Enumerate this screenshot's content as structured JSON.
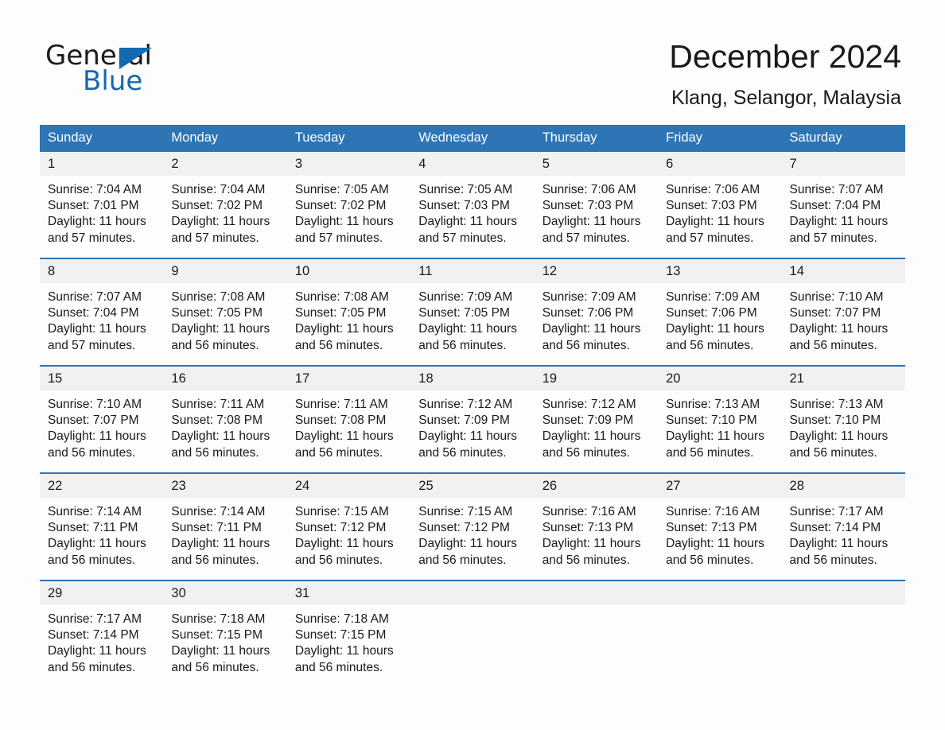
{
  "brand": {
    "name_part1": "General",
    "name_part2": "Blue",
    "triangle_icon": "triangle-icon",
    "accent_color": "#1569b0"
  },
  "header": {
    "title": "December 2024",
    "subtitle": "Klang, Selangor, Malaysia"
  },
  "theme": {
    "header_blue": "#2e75b6",
    "daynum_band": "#f1f1f1",
    "page_background": "#fdfdfd",
    "text": "#1a1a1a"
  },
  "calendar": {
    "weekday_headers": [
      "Sunday",
      "Monday",
      "Tuesday",
      "Wednesday",
      "Thursday",
      "Friday",
      "Saturday"
    ],
    "weeks": [
      [
        {
          "day": "1",
          "sunrise": "Sunrise: 7:04 AM",
          "sunset": "Sunset: 7:01 PM",
          "daylight_line1": "Daylight: 11 hours",
          "daylight_line2": "and 57 minutes."
        },
        {
          "day": "2",
          "sunrise": "Sunrise: 7:04 AM",
          "sunset": "Sunset: 7:02 PM",
          "daylight_line1": "Daylight: 11 hours",
          "daylight_line2": "and 57 minutes."
        },
        {
          "day": "3",
          "sunrise": "Sunrise: 7:05 AM",
          "sunset": "Sunset: 7:02 PM",
          "daylight_line1": "Daylight: 11 hours",
          "daylight_line2": "and 57 minutes."
        },
        {
          "day": "4",
          "sunrise": "Sunrise: 7:05 AM",
          "sunset": "Sunset: 7:03 PM",
          "daylight_line1": "Daylight: 11 hours",
          "daylight_line2": "and 57 minutes."
        },
        {
          "day": "5",
          "sunrise": "Sunrise: 7:06 AM",
          "sunset": "Sunset: 7:03 PM",
          "daylight_line1": "Daylight: 11 hours",
          "daylight_line2": "and 57 minutes."
        },
        {
          "day": "6",
          "sunrise": "Sunrise: 7:06 AM",
          "sunset": "Sunset: 7:03 PM",
          "daylight_line1": "Daylight: 11 hours",
          "daylight_line2": "and 57 minutes."
        },
        {
          "day": "7",
          "sunrise": "Sunrise: 7:07 AM",
          "sunset": "Sunset: 7:04 PM",
          "daylight_line1": "Daylight: 11 hours",
          "daylight_line2": "and 57 minutes."
        }
      ],
      [
        {
          "day": "8",
          "sunrise": "Sunrise: 7:07 AM",
          "sunset": "Sunset: 7:04 PM",
          "daylight_line1": "Daylight: 11 hours",
          "daylight_line2": "and 57 minutes."
        },
        {
          "day": "9",
          "sunrise": "Sunrise: 7:08 AM",
          "sunset": "Sunset: 7:05 PM",
          "daylight_line1": "Daylight: 11 hours",
          "daylight_line2": "and 56 minutes."
        },
        {
          "day": "10",
          "sunrise": "Sunrise: 7:08 AM",
          "sunset": "Sunset: 7:05 PM",
          "daylight_line1": "Daylight: 11 hours",
          "daylight_line2": "and 56 minutes."
        },
        {
          "day": "11",
          "sunrise": "Sunrise: 7:09 AM",
          "sunset": "Sunset: 7:05 PM",
          "daylight_line1": "Daylight: 11 hours",
          "daylight_line2": "and 56 minutes."
        },
        {
          "day": "12",
          "sunrise": "Sunrise: 7:09 AM",
          "sunset": "Sunset: 7:06 PM",
          "daylight_line1": "Daylight: 11 hours",
          "daylight_line2": "and 56 minutes."
        },
        {
          "day": "13",
          "sunrise": "Sunrise: 7:09 AM",
          "sunset": "Sunset: 7:06 PM",
          "daylight_line1": "Daylight: 11 hours",
          "daylight_line2": "and 56 minutes."
        },
        {
          "day": "14",
          "sunrise": "Sunrise: 7:10 AM",
          "sunset": "Sunset: 7:07 PM",
          "daylight_line1": "Daylight: 11 hours",
          "daylight_line2": "and 56 minutes."
        }
      ],
      [
        {
          "day": "15",
          "sunrise": "Sunrise: 7:10 AM",
          "sunset": "Sunset: 7:07 PM",
          "daylight_line1": "Daylight: 11 hours",
          "daylight_line2": "and 56 minutes."
        },
        {
          "day": "16",
          "sunrise": "Sunrise: 7:11 AM",
          "sunset": "Sunset: 7:08 PM",
          "daylight_line1": "Daylight: 11 hours",
          "daylight_line2": "and 56 minutes."
        },
        {
          "day": "17",
          "sunrise": "Sunrise: 7:11 AM",
          "sunset": "Sunset: 7:08 PM",
          "daylight_line1": "Daylight: 11 hours",
          "daylight_line2": "and 56 minutes."
        },
        {
          "day": "18",
          "sunrise": "Sunrise: 7:12 AM",
          "sunset": "Sunset: 7:09 PM",
          "daylight_line1": "Daylight: 11 hours",
          "daylight_line2": "and 56 minutes."
        },
        {
          "day": "19",
          "sunrise": "Sunrise: 7:12 AM",
          "sunset": "Sunset: 7:09 PM",
          "daylight_line1": "Daylight: 11 hours",
          "daylight_line2": "and 56 minutes."
        },
        {
          "day": "20",
          "sunrise": "Sunrise: 7:13 AM",
          "sunset": "Sunset: 7:10 PM",
          "daylight_line1": "Daylight: 11 hours",
          "daylight_line2": "and 56 minutes."
        },
        {
          "day": "21",
          "sunrise": "Sunrise: 7:13 AM",
          "sunset": "Sunset: 7:10 PM",
          "daylight_line1": "Daylight: 11 hours",
          "daylight_line2": "and 56 minutes."
        }
      ],
      [
        {
          "day": "22",
          "sunrise": "Sunrise: 7:14 AM",
          "sunset": "Sunset: 7:11 PM",
          "daylight_line1": "Daylight: 11 hours",
          "daylight_line2": "and 56 minutes."
        },
        {
          "day": "23",
          "sunrise": "Sunrise: 7:14 AM",
          "sunset": "Sunset: 7:11 PM",
          "daylight_line1": "Daylight: 11 hours",
          "daylight_line2": "and 56 minutes."
        },
        {
          "day": "24",
          "sunrise": "Sunrise: 7:15 AM",
          "sunset": "Sunset: 7:12 PM",
          "daylight_line1": "Daylight: 11 hours",
          "daylight_line2": "and 56 minutes."
        },
        {
          "day": "25",
          "sunrise": "Sunrise: 7:15 AM",
          "sunset": "Sunset: 7:12 PM",
          "daylight_line1": "Daylight: 11 hours",
          "daylight_line2": "and 56 minutes."
        },
        {
          "day": "26",
          "sunrise": "Sunrise: 7:16 AM",
          "sunset": "Sunset: 7:13 PM",
          "daylight_line1": "Daylight: 11 hours",
          "daylight_line2": "and 56 minutes."
        },
        {
          "day": "27",
          "sunrise": "Sunrise: 7:16 AM",
          "sunset": "Sunset: 7:13 PM",
          "daylight_line1": "Daylight: 11 hours",
          "daylight_line2": "and 56 minutes."
        },
        {
          "day": "28",
          "sunrise": "Sunrise: 7:17 AM",
          "sunset": "Sunset: 7:14 PM",
          "daylight_line1": "Daylight: 11 hours",
          "daylight_line2": "and 56 minutes."
        }
      ],
      [
        {
          "day": "29",
          "sunrise": "Sunrise: 7:17 AM",
          "sunset": "Sunset: 7:14 PM",
          "daylight_line1": "Daylight: 11 hours",
          "daylight_line2": "and 56 minutes."
        },
        {
          "day": "30",
          "sunrise": "Sunrise: 7:18 AM",
          "sunset": "Sunset: 7:15 PM",
          "daylight_line1": "Daylight: 11 hours",
          "daylight_line2": "and 56 minutes."
        },
        {
          "day": "31",
          "sunrise": "Sunrise: 7:18 AM",
          "sunset": "Sunset: 7:15 PM",
          "daylight_line1": "Daylight: 11 hours",
          "daylight_line2": "and 56 minutes."
        },
        {
          "day": "",
          "sunrise": "",
          "sunset": "",
          "daylight_line1": "",
          "daylight_line2": ""
        },
        {
          "day": "",
          "sunrise": "",
          "sunset": "",
          "daylight_line1": "",
          "daylight_line2": ""
        },
        {
          "day": "",
          "sunrise": "",
          "sunset": "",
          "daylight_line1": "",
          "daylight_line2": ""
        },
        {
          "day": "",
          "sunrise": "",
          "sunset": "",
          "daylight_line1": "",
          "daylight_line2": ""
        }
      ]
    ]
  }
}
